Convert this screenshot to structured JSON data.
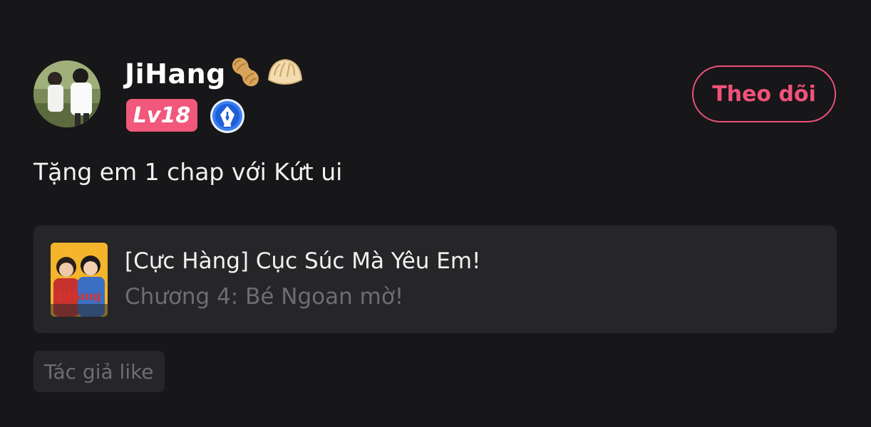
{
  "user": {
    "name": "JiHang",
    "emojis": [
      {
        "icon": "peanut-icon",
        "glyph": "🥜"
      },
      {
        "icon": "dumpling-icon",
        "glyph": "🥟"
      }
    ],
    "level": "Lv18",
    "avatar_icon": "user-avatar",
    "badge_icon": "pen-nib-badge-icon"
  },
  "follow_button": {
    "label": "Theo dõi",
    "color": "#f0527a"
  },
  "post": {
    "text": "Tặng em 1 chap với Kứt ui"
  },
  "comic": {
    "title": "[Cực Hàng] Cục Súc Mà Yêu Em!",
    "chapter": "Chương 4: Bé Ngoan mờ!",
    "cover_icon": "comic-cover-image",
    "cover_lettering": "JiHang"
  },
  "author_like": {
    "label": "Tác giả like"
  },
  "colors": {
    "background": "#171618",
    "card": "#262528",
    "accent": "#f0527a",
    "level_badge": "#f2577c",
    "muted_text": "#6e6d71"
  }
}
